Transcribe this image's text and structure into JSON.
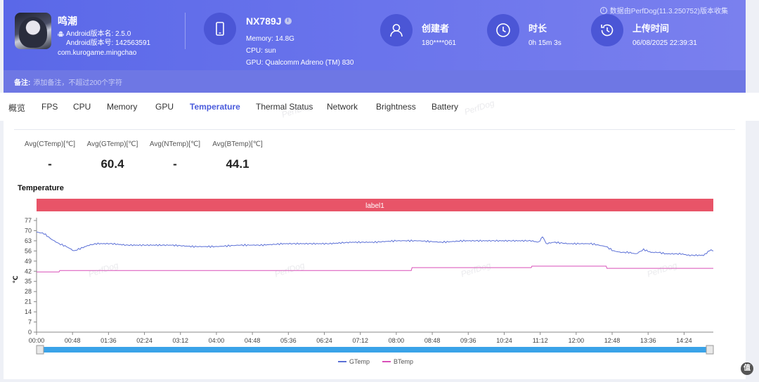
{
  "header": {
    "source_tag": "数据由PerfDog(11.3.250752)版本收集",
    "app": {
      "name": "鸣潮",
      "version_label": "Android版本名: 2.5.0",
      "build_label": "Android版本号: 142563591",
      "package": "com.kurogame.mingchao"
    },
    "device": {
      "name": "NX789J",
      "memory": "Memory: 14.8G",
      "cpu": "CPU: sun",
      "gpu": "GPU: Qualcomm Adreno (TM) 830"
    },
    "creator": {
      "title": "创建者",
      "value": "180****061"
    },
    "duration": {
      "title": "时长",
      "value": "0h 15m 3s"
    },
    "upload": {
      "title": "上传时间",
      "value": "06/08/2025 22:39:31"
    },
    "note": {
      "label": "备注:",
      "placeholder": "添加备注，不超过200个字符"
    }
  },
  "tabs": [
    "概览",
    "FPS",
    "CPU",
    "Memory",
    "GPU",
    "Temperature",
    "Thermal Status",
    "Network",
    "Brightness",
    "Battery"
  ],
  "active_tab": "Temperature",
  "watermark": "PerfDog",
  "averages": [
    {
      "label": "Avg(CTemp)[℃]",
      "value": "-"
    },
    {
      "label": "Avg(GTemp)[℃]",
      "value": "60.4"
    },
    {
      "label": "Avg(NTemp)[℃]",
      "value": "-"
    },
    {
      "label": "Avg(BTemp)[℃]",
      "value": "44.1"
    }
  ],
  "chart_title": "Temperature",
  "colors": {
    "accent": "#4a5bdc",
    "header": "#5a68e8",
    "label_bar": "#e85468",
    "gtemp": "#5a6fd6",
    "btemp": "#d94fb8",
    "slider": "#3aa3e8"
  },
  "chart_data": {
    "type": "line",
    "ylabel": "℃",
    "yticks": [
      0,
      7,
      14,
      21,
      28,
      35,
      42,
      49,
      56,
      63,
      70,
      77
    ],
    "ylim": [
      0,
      77
    ],
    "xticks": [
      "00:00",
      "00:48",
      "01:36",
      "02:24",
      "03:12",
      "04:00",
      "04:48",
      "05:36",
      "06:24",
      "07:12",
      "08:00",
      "08:48",
      "09:36",
      "10:24",
      "11:12",
      "12:00",
      "12:48",
      "13:36",
      "14:24"
    ],
    "xlim_seconds": [
      0,
      903
    ],
    "label_bar": "label1",
    "series": [
      {
        "name": "GTemp",
        "x": [
          0,
          10,
          20,
          30,
          40,
          50,
          60,
          70,
          80,
          100,
          120,
          150,
          180,
          210,
          240,
          270,
          300,
          330,
          360,
          390,
          420,
          450,
          480,
          510,
          540,
          570,
          600,
          630,
          660,
          670,
          675,
          680,
          690,
          710,
          740,
          760,
          770,
          780,
          790,
          800,
          810,
          820,
          830,
          840,
          850,
          860,
          870,
          880,
          890,
          900,
          903
        ],
        "values": [
          69,
          68,
          64,
          61,
          59,
          56,
          58,
          60,
          61,
          61,
          60,
          60,
          60,
          59,
          59,
          60,
          60,
          61,
          61,
          61,
          62,
          62,
          63,
          63,
          62,
          63,
          63,
          63,
          63,
          62,
          66,
          61,
          62,
          61,
          61,
          59,
          56,
          55,
          55,
          54,
          57,
          55,
          55,
          54,
          54,
          54,
          53,
          53,
          53,
          57,
          56
        ]
      },
      {
        "name": "BTemp",
        "x": [
          0,
          30,
          31,
          500,
          501,
          660,
          661,
          760,
          761,
          903
        ],
        "values": [
          41.5,
          41.5,
          42.5,
          42.5,
          44.5,
          44.5,
          45.5,
          45.5,
          44,
          44
        ]
      }
    ],
    "legend": [
      "GTemp",
      "BTemp"
    ],
    "grid": false
  }
}
